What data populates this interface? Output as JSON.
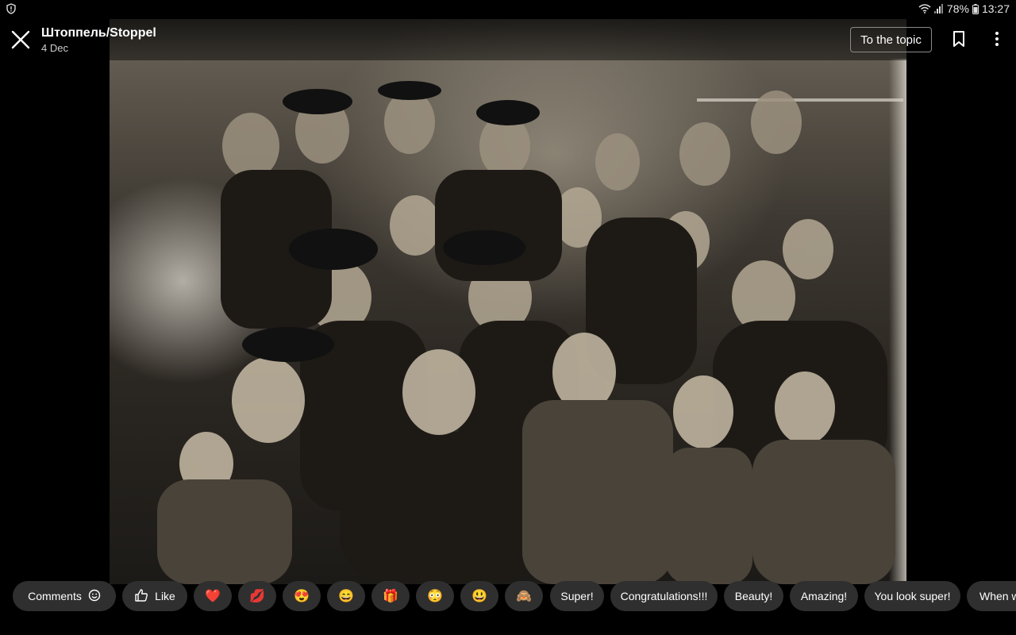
{
  "status_bar": {
    "battery": "78%",
    "time": "13:27",
    "icons": [
      "shield-icon",
      "wifi-icon",
      "signal-icon",
      "battery-icon"
    ]
  },
  "header": {
    "title": "Штоппель/Stoppel",
    "date": "4 Dec",
    "topic_button": "To the topic",
    "icons": [
      "close-icon",
      "bookmark-icon",
      "more-vertical-icon"
    ]
  },
  "photo": {
    "subject": "vintage sepia group photograph"
  },
  "reactions": {
    "comments_label": "Comments",
    "like_label": "Like",
    "emojis": [
      "❤️",
      "💋",
      "😍",
      "😄",
      "🎁",
      "😳",
      "😃",
      "🙈"
    ],
    "phrases": [
      "Super!",
      "Congratulations!!!",
      "Beauty!",
      "Amazing!",
      "You look super!",
      "When w"
    ]
  },
  "colors": {
    "background": "#000000",
    "chip": "#2f2f2f",
    "text": "#ffffff"
  }
}
